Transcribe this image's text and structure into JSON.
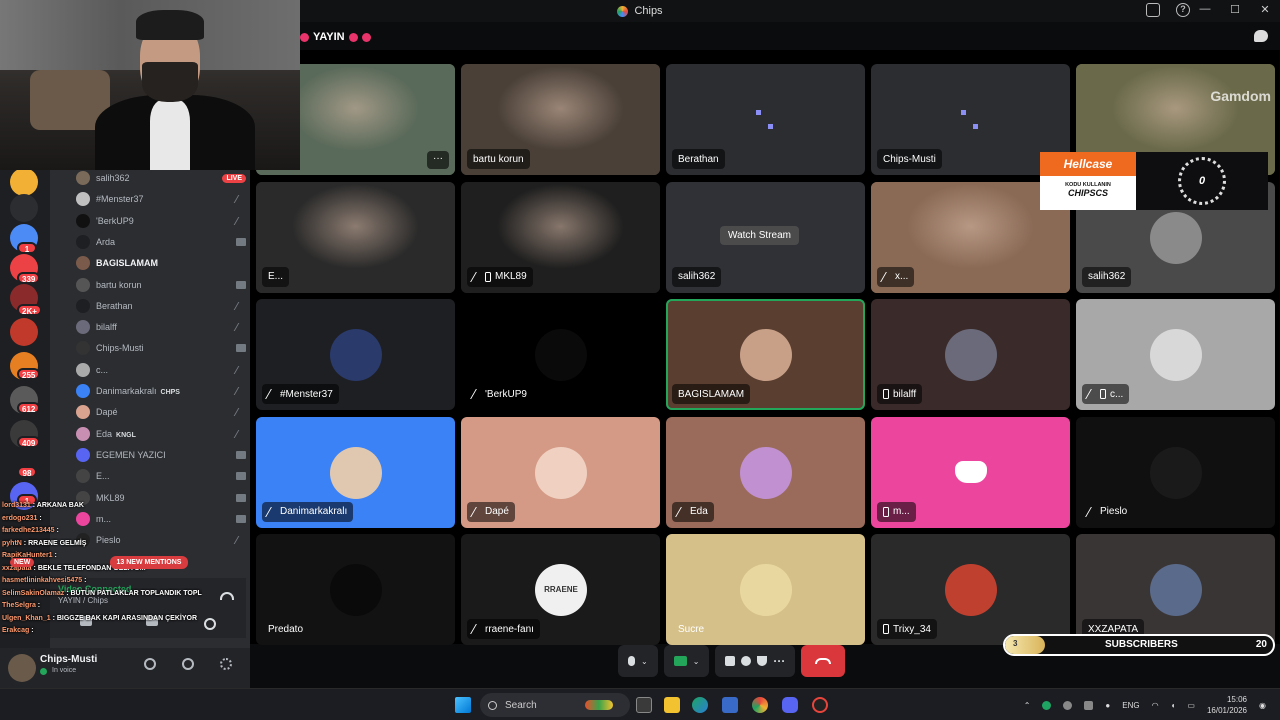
{
  "window": {
    "title": "Chips"
  },
  "stage": {
    "title": "YAYIN"
  },
  "members": [
    {
      "name": "salih362",
      "badge": "LIVE",
      "color": "#7a6a5a"
    },
    {
      "name": "#Menster37",
      "color": "#c0c0c0",
      "icon": "mute"
    },
    {
      "name": "'BerkUP9",
      "color": "#111111",
      "icon": "mute"
    },
    {
      "name": "Arda",
      "color": "#1e1f22",
      "icon": "cam"
    },
    {
      "name": "BAGISLAMAM",
      "color": "#7a5a4a",
      "bold": true
    },
    {
      "name": "bartu korun",
      "color": "#555555",
      "icon": "cam"
    },
    {
      "name": "Berathan",
      "color": "#1e1f22",
      "icon": "mute"
    },
    {
      "name": "bilalff",
      "color": "#6a6a7a",
      "icon": "mute"
    },
    {
      "name": "Chips-Musti",
      "color": "#333333",
      "icon": "cam"
    },
    {
      "name": "c...",
      "color": "#aaaaaa",
      "icon": "mute"
    },
    {
      "name": "Danimarkakralı",
      "color": "#3b82f6",
      "tag": "CHPS",
      "icon": "mute"
    },
    {
      "name": "Dapé",
      "color": "#d9a38f",
      "icon": "mute"
    },
    {
      "name": "Eda",
      "color": "#c98fb3",
      "tag": "KNGL",
      "icon": "mute"
    },
    {
      "name": "EGEMEN YAZICI",
      "color": "#5865f2",
      "icon": "cam"
    },
    {
      "name": "E...",
      "color": "#444444",
      "icon": "cam"
    },
    {
      "name": "MKL89",
      "color": "#444444",
      "icon": "cam"
    },
    {
      "name": "m...",
      "color": "#eb459e",
      "icon": "cam"
    },
    {
      "name": "Pieslo",
      "color": "#222222",
      "icon": "mute"
    }
  ],
  "server_badges": [
    "1",
    "339",
    "2K+",
    "255",
    "612",
    "409",
    "98",
    "1"
  ],
  "chat": [
    {
      "user": "lord3131",
      "msg": "ARKANA BAK"
    },
    {
      "user": "erdogo231",
      "msg": ""
    },
    {
      "user": "farkedhe213445",
      "msg": ""
    },
    {
      "user": "pyhtN",
      "msg": "RRAENE GELMİŞ"
    },
    {
      "user": "RapiKaHunter1",
      "msg": ""
    },
    {
      "user": "xxzapata",
      "msg": "BEKLE TELEFONDAN GELİYOM"
    },
    {
      "user": "hasmetlininkahvesi5475",
      "msg": ""
    },
    {
      "user": "SelimSakinOlamaz",
      "msg": "BÜTÜN PATLAKLAR TOPLANDIK TOPLANDIK"
    },
    {
      "user": "TheSelgra",
      "msg": ""
    },
    {
      "user": "Ulgen_Khan_1",
      "msg": "BIGGZE BAK KAPI ARASINDAN ÇEKİYOR"
    },
    {
      "user": "Erakcag",
      "msg": ""
    }
  ],
  "mentions_label": "13 NEW MENTIONS",
  "new_label": "NEW",
  "voice": {
    "connected": "Video Connected",
    "channel": "YAYIN / Chips"
  },
  "user_panel": {
    "name": "Chips-Musti",
    "status": "In voice"
  },
  "tiles": [
    {
      "name": "",
      "bg": "#5a6a5a",
      "type": "cam",
      "dots": true
    },
    {
      "name": "bartu korun",
      "bg": "#4a4038",
      "type": "cam"
    },
    {
      "name": "Berathan",
      "bg": "#2b2d31",
      "type": "empty"
    },
    {
      "name": "Chips-Musti",
      "bg": "#2b2d31",
      "type": "empty"
    },
    {
      "name": "",
      "bg": "#6a6a4a",
      "type": "cam",
      "overlay": "Gamdom"
    },
    {
      "name": "E...",
      "bg": "#2a2a2a",
      "type": "cam"
    },
    {
      "name": "MKL89",
      "bg": "#1f1f1f",
      "type": "cam",
      "icons": "mute-phone"
    },
    {
      "name": "salih362",
      "bg": "#2f3136",
      "type": "stream",
      "watch": "Watch Stream"
    },
    {
      "name": "x...",
      "bg": "#8a6a55",
      "type": "cam",
      "icons": "mute"
    },
    {
      "name": "salih362",
      "bg": "#4a4a4a",
      "type": "pfp",
      "pfp": "#8a8a8a"
    },
    {
      "name": "#Menster37",
      "bg": "#1e1f22",
      "type": "pfp",
      "pfp": "#2a3a6a",
      "icons": "mute"
    },
    {
      "name": "'BerkUP9",
      "bg": "#000000",
      "type": "pfp",
      "pfp": "#0a0a0a",
      "icons": "mute"
    },
    {
      "name": "BAGISLAMAM",
      "bg": "#5a3e30",
      "type": "pfp",
      "pfp": "#c8a088",
      "speaking": true
    },
    {
      "name": "bilalff",
      "bg": "#3a2a2a",
      "type": "pfp",
      "pfp": "#6a6a7a",
      "icons": "phone"
    },
    {
      "name": "c...",
      "bg": "#a8a8a8",
      "type": "pfp",
      "pfp": "#d8d8d8",
      "icons": "mute-phone"
    },
    {
      "name": "Danimarkakralı",
      "bg": "#3b82f6",
      "type": "pfp",
      "pfp": "#e0c8b0",
      "icons": "mute"
    },
    {
      "name": "Dapé",
      "bg": "#d49a86",
      "type": "pfp",
      "pfp": "#f0d0c0",
      "icons": "mute"
    },
    {
      "name": "Eda",
      "bg": "#9a6a5a",
      "type": "pfp",
      "pfp": "#c090d0",
      "icons": "mute"
    },
    {
      "name": "m...",
      "bg": "#eb459e",
      "type": "discord",
      "icons": "phone"
    },
    {
      "name": "Pieslo",
      "bg": "#101010",
      "type": "pfp",
      "pfp": "#1a1a1a",
      "icons": "mute",
      "plain": true
    },
    {
      "name": "Predato",
      "bg": "#121212",
      "type": "pfp",
      "pfp": "#0a0a0a",
      "plain": true
    },
    {
      "name": "rraene-fanı",
      "bg": "#1a1a1a",
      "type": "pfp",
      "pfp": "#f0f0f0",
      "icons": "mute",
      "pfp_text": "RRAENE"
    },
    {
      "name": "Sucre",
      "bg": "#d6c08a",
      "type": "pfp",
      "pfp": "#e8d8a0",
      "plain": true
    },
    {
      "name": "Trixy_34",
      "bg": "#2a2a2a",
      "type": "pfp",
      "pfp": "#c04030",
      "icons": "phone"
    },
    {
      "name": "XXZAPATA",
      "bg": "#3a3535",
      "type": "pfp",
      "pfp": "#5a6a8a"
    }
  ],
  "ad": {
    "brand": "Hellcase",
    "kodu": "KODU KULLANIN",
    "code": "CHIPSCS",
    "counter": "0"
  },
  "subs": {
    "current": "3",
    "label": "SUBSCRIBERS",
    "goal": "20",
    "progress": 0.15
  },
  "taskbar": {
    "search": "Search",
    "lang": "ENG",
    "time": "15:06",
    "date": "16/01/2026"
  },
  "colors": {
    "accent": "#5865f2",
    "live": "#ed4245",
    "speaking": "#23a55a"
  }
}
